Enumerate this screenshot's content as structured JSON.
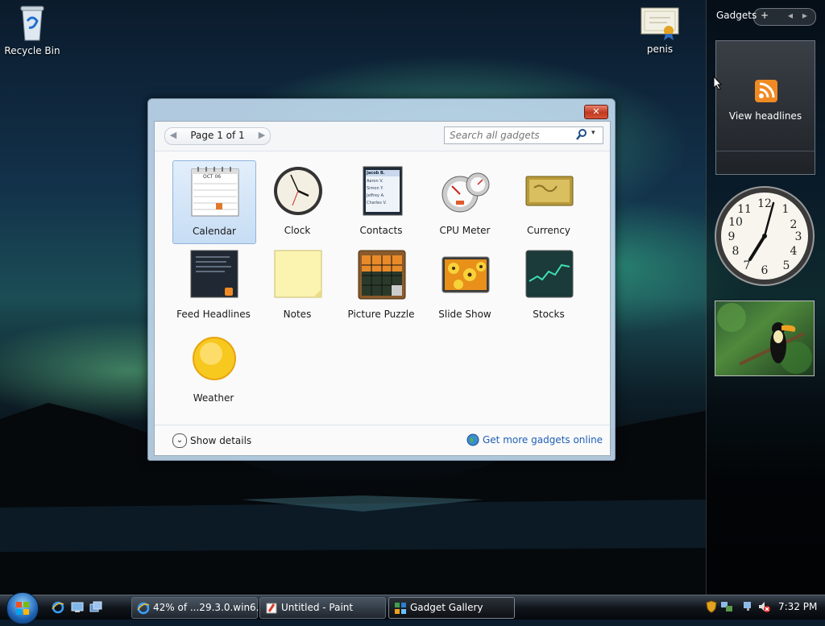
{
  "desktop": {
    "icons": [
      {
        "label": "Recycle Bin",
        "icon": "recycle-bin-icon"
      },
      {
        "label": "penis",
        "icon": "certificate-document-icon"
      }
    ]
  },
  "sidebar": {
    "title": "Gadgets",
    "add_label": "+",
    "prev_label": "◀",
    "next_label": "▶",
    "feed_gadget": {
      "label": "View headlines",
      "icon": "rss-icon",
      "accent": "#f08a24"
    },
    "clock_gadget": {
      "icon": "analog-clock-icon"
    },
    "slideshow_gadget": {
      "icon": "toucan-photo"
    }
  },
  "window": {
    "title": "Gadget Gallery",
    "close_label": "✕",
    "pager": {
      "label": "Page 1 of 1",
      "prev": "◀",
      "next": "▶"
    },
    "search": {
      "placeholder": "Search all gadgets",
      "icon": "search-icon",
      "dropdown": "▾"
    },
    "gadgets": [
      {
        "label": "Calendar",
        "icon": "calendar-icon",
        "selected": true
      },
      {
        "label": "Clock",
        "icon": "clock-icon"
      },
      {
        "label": "Contacts",
        "icon": "contacts-icon"
      },
      {
        "label": "CPU Meter",
        "icon": "cpu-meter-icon"
      },
      {
        "label": "Currency",
        "icon": "currency-icon"
      },
      {
        "label": "Feed Headlines",
        "icon": "feed-headlines-icon"
      },
      {
        "label": "Notes",
        "icon": "notes-icon"
      },
      {
        "label": "Picture Puzzle",
        "icon": "picture-puzzle-icon"
      },
      {
        "label": "Slide Show",
        "icon": "slide-show-icon"
      },
      {
        "label": "Stocks",
        "icon": "stocks-icon"
      },
      {
        "label": "Weather",
        "icon": "weather-icon"
      }
    ],
    "calendar_thumb": {
      "month": "OCT 06"
    },
    "contacts_thumb": {
      "names": [
        "Jacob B.",
        "Aaron V.",
        "Simon Y.",
        "Jeffrey A.",
        "Charles V."
      ]
    },
    "footer": {
      "details_label": "Show details",
      "details_icon": "chevron-down-icon",
      "more_label": "Get more gadgets online",
      "more_icon": "globe-icon",
      "link_color": "#1f5fb6"
    }
  },
  "taskbar": {
    "start_icon": "windows-orb-icon",
    "quick_launch": [
      "internet-explorer-icon",
      "show-desktop-icon",
      "switch-windows-icon"
    ],
    "tasks": [
      {
        "label": "42% of ...29.3.0.win6...",
        "icon": "internet-explorer-icon"
      },
      {
        "label": "Untitled - Paint",
        "icon": "paint-icon"
      },
      {
        "label": "Gadget Gallery",
        "icon": "gadget-gallery-icon",
        "active": true
      }
    ],
    "tray_icons": [
      "security-shield-icon",
      "network-icon",
      "network-disconnected-icon",
      "volume-muted-icon"
    ],
    "clock": "7:32 PM"
  }
}
